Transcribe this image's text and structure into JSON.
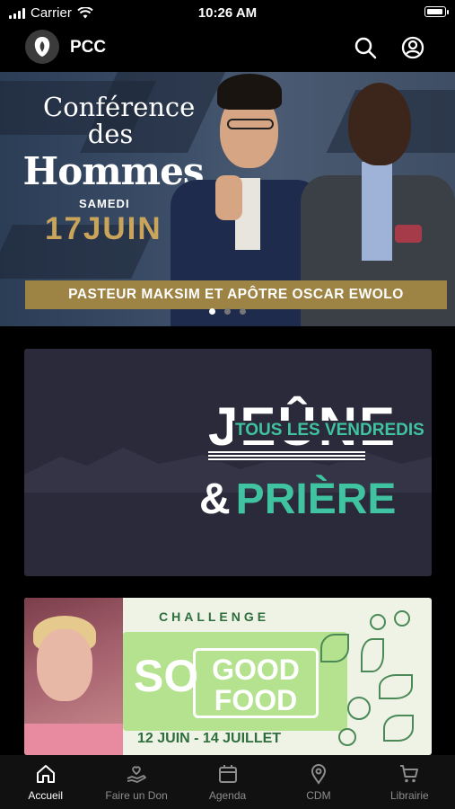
{
  "status_bar": {
    "carrier": "Carrier",
    "time": "10:26 AM"
  },
  "header": {
    "brand": "PCC",
    "icons": [
      "lion-logo-icon",
      "search-icon",
      "account-icon"
    ]
  },
  "hero": {
    "title_line1": "Conférence des",
    "title_line2": "Hommes",
    "day": "SAMEDI",
    "date": "17JUIN",
    "banner": "PASTEUR MAKSIM ET APÔTRE OSCAR EWOLO",
    "carousel": {
      "count": 3,
      "active": 1
    },
    "accent_color": "#c8a55a"
  },
  "card_jeune": {
    "title_top": "JEÛNE",
    "overlay": "TOUS LES VENDREDIS",
    "ampersand": "&",
    "title_bottom": "PRIÈRE",
    "accent_color": "#3fc3a0"
  },
  "card_food": {
    "challenge": "CHALLENGE",
    "so": "SO",
    "good": "GOOD",
    "food": "FOOD",
    "dates": "12 JUIN - 14 JUILLET"
  },
  "tabs": [
    {
      "label": "Accueil",
      "icon": "home-icon",
      "active": true
    },
    {
      "label": "Faire un Don",
      "icon": "donate-hand-icon",
      "active": false
    },
    {
      "label": "Agenda",
      "icon": "calendar-icon",
      "active": false
    },
    {
      "label": "CDM",
      "icon": "location-pin-icon",
      "active": false
    },
    {
      "label": "Librairie",
      "icon": "cart-icon",
      "active": false
    }
  ]
}
